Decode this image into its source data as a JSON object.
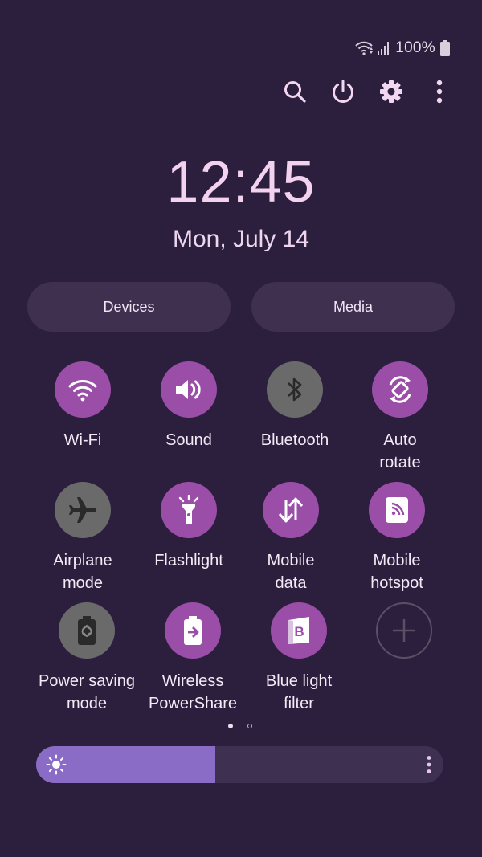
{
  "status_bar": {
    "battery_percent": "100%"
  },
  "actions": {
    "search": "search-icon",
    "power": "power-icon",
    "settings": "gear-icon",
    "more": "more-vert-icon"
  },
  "clock": {
    "time": "12:45",
    "date": "Mon, July 14"
  },
  "pills": {
    "devices": "Devices",
    "media": "Media"
  },
  "tiles": [
    {
      "line1": "Wi-Fi",
      "line2": "",
      "state": "on"
    },
    {
      "line1": "Sound",
      "line2": "",
      "state": "on"
    },
    {
      "line1": "Bluetooth",
      "line2": "",
      "state": "off"
    },
    {
      "line1": "Auto",
      "line2": "rotate",
      "state": "on"
    },
    {
      "line1": "Airplane",
      "line2": "mode",
      "state": "off"
    },
    {
      "line1": "Flashlight",
      "line2": "",
      "state": "on"
    },
    {
      "line1": "Mobile",
      "line2": "data",
      "state": "on"
    },
    {
      "line1": "Mobile",
      "line2": "hotspot",
      "state": "on"
    },
    {
      "line1": "Power saving",
      "line2": "mode",
      "state": "off"
    },
    {
      "line1": "Wireless",
      "line2": "PowerShare",
      "state": "on"
    },
    {
      "line1": "Blue light",
      "line2": "filter",
      "state": "on"
    }
  ],
  "page_indicator": {
    "current": 1,
    "total": 2
  },
  "brightness": {
    "level": 0.44
  },
  "colors": {
    "background": "#2c1e3d",
    "tile_on": "#9a4ea8",
    "tile_off": "#6a6a6a",
    "brightness_fill": "#8a6cc7",
    "clock": "#f3d2f0"
  }
}
